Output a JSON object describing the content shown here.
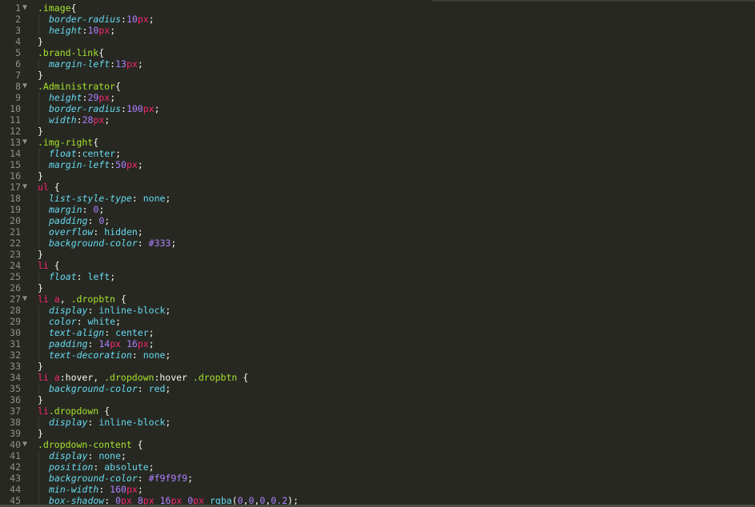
{
  "editor": {
    "language": "CSS",
    "theme_colors": {
      "background": "#272822",
      "selector": "#a6e22e",
      "tag": "#f92672",
      "property": "#66d9ef",
      "number": "#ae81ff",
      "unit": "#f92672",
      "gutter": "#8f908a"
    },
    "lines": [
      {
        "n": "1",
        "fold": true,
        "tokens": [
          [
            "sel",
            ".image"
          ],
          [
            "punc",
            "{"
          ]
        ]
      },
      {
        "n": "2",
        "indent": 1,
        "tokens": [
          [
            "prop",
            "border-radius"
          ],
          [
            "punc",
            ":"
          ],
          [
            "num",
            "10"
          ],
          [
            "unit",
            "px"
          ],
          [
            "punc",
            ";"
          ]
        ]
      },
      {
        "n": "3",
        "indent": 1,
        "tokens": [
          [
            "prop",
            "height"
          ],
          [
            "punc",
            ":"
          ],
          [
            "num",
            "10"
          ],
          [
            "unit",
            "px"
          ],
          [
            "punc",
            ";"
          ]
        ]
      },
      {
        "n": "4",
        "tokens": [
          [
            "punc",
            "}"
          ]
        ]
      },
      {
        "n": "5",
        "tokens": [
          [
            "sel",
            ".brand-link"
          ],
          [
            "punc",
            "{"
          ]
        ]
      },
      {
        "n": "6",
        "indent": 1,
        "tokens": [
          [
            "prop",
            "margin-left"
          ],
          [
            "punc",
            ":"
          ],
          [
            "num",
            "13"
          ],
          [
            "unit",
            "px"
          ],
          [
            "punc",
            ";"
          ]
        ]
      },
      {
        "n": "7",
        "tokens": [
          [
            "punc",
            "}"
          ]
        ]
      },
      {
        "n": "8",
        "fold": true,
        "tokens": [
          [
            "sel",
            ".Administrator"
          ],
          [
            "punc",
            "{"
          ]
        ]
      },
      {
        "n": "9",
        "indent": 1,
        "tokens": [
          [
            "prop",
            "height"
          ],
          [
            "punc",
            ":"
          ],
          [
            "num",
            "29"
          ],
          [
            "unit",
            "px"
          ],
          [
            "punc",
            ";"
          ]
        ]
      },
      {
        "n": "10",
        "indent": 1,
        "tokens": [
          [
            "prop",
            "border-radius"
          ],
          [
            "punc",
            ":"
          ],
          [
            "num",
            "100"
          ],
          [
            "unit",
            "px"
          ],
          [
            "punc",
            ";"
          ]
        ]
      },
      {
        "n": "11",
        "indent": 1,
        "tokens": [
          [
            "prop",
            "width"
          ],
          [
            "punc",
            ":"
          ],
          [
            "num",
            "28"
          ],
          [
            "unit",
            "px"
          ],
          [
            "punc",
            ";"
          ]
        ]
      },
      {
        "n": "12",
        "tokens": [
          [
            "punc",
            "}"
          ]
        ]
      },
      {
        "n": "13",
        "fold": true,
        "tokens": [
          [
            "sel",
            ".img-right"
          ],
          [
            "punc",
            "{"
          ]
        ]
      },
      {
        "n": "14",
        "indent": 1,
        "tokens": [
          [
            "prop",
            "float"
          ],
          [
            "punc",
            ":"
          ],
          [
            "val",
            "center"
          ],
          [
            "punc",
            ";"
          ]
        ]
      },
      {
        "n": "15",
        "indent": 1,
        "tokens": [
          [
            "prop",
            "margin-left"
          ],
          [
            "punc",
            ":"
          ],
          [
            "num",
            "50"
          ],
          [
            "unit",
            "px"
          ],
          [
            "punc",
            ";"
          ]
        ]
      },
      {
        "n": "16",
        "tokens": [
          [
            "punc",
            "}"
          ]
        ]
      },
      {
        "n": "17",
        "fold": true,
        "tokens": [
          [
            "tag",
            "ul"
          ],
          [
            "punc",
            " {"
          ]
        ]
      },
      {
        "n": "18",
        "indent": 1,
        "tokens": [
          [
            "prop",
            "list-style-type"
          ],
          [
            "punc",
            ": "
          ],
          [
            "val",
            "none"
          ],
          [
            "punc",
            ";"
          ]
        ]
      },
      {
        "n": "19",
        "indent": 1,
        "tokens": [
          [
            "prop",
            "margin"
          ],
          [
            "punc",
            ": "
          ],
          [
            "num",
            "0"
          ],
          [
            "punc",
            ";"
          ]
        ]
      },
      {
        "n": "20",
        "indent": 1,
        "tokens": [
          [
            "prop",
            "padding"
          ],
          [
            "punc",
            ": "
          ],
          [
            "num",
            "0"
          ],
          [
            "punc",
            ";"
          ]
        ]
      },
      {
        "n": "21",
        "indent": 1,
        "tokens": [
          [
            "prop",
            "overflow"
          ],
          [
            "punc",
            ": "
          ],
          [
            "val",
            "hidden"
          ],
          [
            "punc",
            ";"
          ]
        ]
      },
      {
        "n": "22",
        "indent": 1,
        "tokens": [
          [
            "prop",
            "background-color"
          ],
          [
            "punc",
            ": "
          ],
          [
            "num",
            "#333"
          ],
          [
            "punc",
            ";"
          ]
        ]
      },
      {
        "n": "23",
        "tokens": [
          [
            "punc",
            "}"
          ]
        ]
      },
      {
        "n": "24",
        "tokens": [
          [
            "tag",
            "li"
          ],
          [
            "punc",
            " {"
          ]
        ]
      },
      {
        "n": "25",
        "indent": 1,
        "tokens": [
          [
            "prop",
            "float"
          ],
          [
            "punc",
            ": "
          ],
          [
            "val",
            "left"
          ],
          [
            "punc",
            ";"
          ]
        ]
      },
      {
        "n": "26",
        "tokens": [
          [
            "punc",
            "}"
          ]
        ]
      },
      {
        "n": "27",
        "fold": true,
        "tokens": [
          [
            "tag",
            "li"
          ],
          [
            "punc",
            " "
          ],
          [
            "tag",
            "a"
          ],
          [
            "punc",
            ", "
          ],
          [
            "sel",
            ".dropbtn"
          ],
          [
            "punc",
            " {"
          ]
        ]
      },
      {
        "n": "28",
        "indent": 1,
        "tokens": [
          [
            "prop",
            "display"
          ],
          [
            "punc",
            ": "
          ],
          [
            "val",
            "inline-block"
          ],
          [
            "punc",
            ";"
          ]
        ]
      },
      {
        "n": "29",
        "indent": 1,
        "tokens": [
          [
            "prop",
            "color"
          ],
          [
            "punc",
            ": "
          ],
          [
            "val",
            "white"
          ],
          [
            "punc",
            ";"
          ]
        ]
      },
      {
        "n": "30",
        "indent": 1,
        "tokens": [
          [
            "prop",
            "text-align"
          ],
          [
            "punc",
            ": "
          ],
          [
            "val",
            "center"
          ],
          [
            "punc",
            ";"
          ]
        ]
      },
      {
        "n": "31",
        "indent": 1,
        "tokens": [
          [
            "prop",
            "padding"
          ],
          [
            "punc",
            ": "
          ],
          [
            "num",
            "14"
          ],
          [
            "unit",
            "px"
          ],
          [
            "punc",
            " "
          ],
          [
            "num",
            "16"
          ],
          [
            "unit",
            "px"
          ],
          [
            "punc",
            ";"
          ]
        ]
      },
      {
        "n": "32",
        "indent": 1,
        "tokens": [
          [
            "prop",
            "text-decoration"
          ],
          [
            "punc",
            ": "
          ],
          [
            "val",
            "none"
          ],
          [
            "punc",
            ";"
          ]
        ]
      },
      {
        "n": "33",
        "tokens": [
          [
            "punc",
            "}"
          ]
        ]
      },
      {
        "n": "34",
        "tokens": [
          [
            "tag",
            "li"
          ],
          [
            "punc",
            " "
          ],
          [
            "tag",
            "a"
          ],
          [
            "punc",
            ":hover, "
          ],
          [
            "sel",
            ".dropdown"
          ],
          [
            "punc",
            ":hover "
          ],
          [
            "sel",
            ".dropbtn"
          ],
          [
            "punc",
            " {"
          ]
        ]
      },
      {
        "n": "35",
        "indent": 1,
        "tokens": [
          [
            "prop",
            "background-color"
          ],
          [
            "punc",
            ": "
          ],
          [
            "val",
            "red"
          ],
          [
            "punc",
            ";"
          ]
        ]
      },
      {
        "n": "36",
        "tokens": [
          [
            "punc",
            "}"
          ]
        ]
      },
      {
        "n": "37",
        "tokens": [
          [
            "tag",
            "li"
          ],
          [
            "sel",
            ".dropdown"
          ],
          [
            "punc",
            " {"
          ]
        ]
      },
      {
        "n": "38",
        "indent": 1,
        "tokens": [
          [
            "prop",
            "display"
          ],
          [
            "punc",
            ": "
          ],
          [
            "val",
            "inline-block"
          ],
          [
            "punc",
            ";"
          ]
        ]
      },
      {
        "n": "39",
        "tokens": [
          [
            "punc",
            "}"
          ]
        ]
      },
      {
        "n": "40",
        "fold": true,
        "tokens": [
          [
            "sel",
            ".dropdown-content"
          ],
          [
            "punc",
            " {"
          ]
        ]
      },
      {
        "n": "41",
        "indent": 1,
        "tokens": [
          [
            "prop",
            "display"
          ],
          [
            "punc",
            ": "
          ],
          [
            "val",
            "none"
          ],
          [
            "punc",
            ";"
          ]
        ]
      },
      {
        "n": "42",
        "indent": 1,
        "tokens": [
          [
            "prop",
            "position"
          ],
          [
            "punc",
            ": "
          ],
          [
            "val",
            "absolute"
          ],
          [
            "punc",
            ";"
          ]
        ]
      },
      {
        "n": "43",
        "indent": 1,
        "tokens": [
          [
            "prop",
            "background-color"
          ],
          [
            "punc",
            ": "
          ],
          [
            "num",
            "#f9f9f9"
          ],
          [
            "punc",
            ";"
          ]
        ]
      },
      {
        "n": "44",
        "indent": 1,
        "tokens": [
          [
            "prop",
            "min-width"
          ],
          [
            "punc",
            ": "
          ],
          [
            "num",
            "160"
          ],
          [
            "unit",
            "px"
          ],
          [
            "punc",
            ";"
          ]
        ]
      },
      {
        "n": "45",
        "indent": 1,
        "tokens": [
          [
            "prop",
            "box-shadow"
          ],
          [
            "punc",
            ": "
          ],
          [
            "num",
            "0"
          ],
          [
            "unit",
            "px"
          ],
          [
            "punc",
            " "
          ],
          [
            "num",
            "8"
          ],
          [
            "unit",
            "px"
          ],
          [
            "punc",
            " "
          ],
          [
            "num",
            "16"
          ],
          [
            "unit",
            "px"
          ],
          [
            "punc",
            " "
          ],
          [
            "num",
            "0"
          ],
          [
            "unit",
            "px"
          ],
          [
            "punc",
            " "
          ],
          [
            "val",
            "rgba"
          ],
          [
            "punc",
            "("
          ],
          [
            "num",
            "0"
          ],
          [
            "punc",
            ","
          ],
          [
            "num",
            "0"
          ],
          [
            "punc",
            ","
          ],
          [
            "num",
            "0"
          ],
          [
            "punc",
            ","
          ],
          [
            "num",
            "0.2"
          ],
          [
            "punc",
            ");"
          ]
        ]
      }
    ],
    "fold_icon": "triangle-down-icon"
  }
}
